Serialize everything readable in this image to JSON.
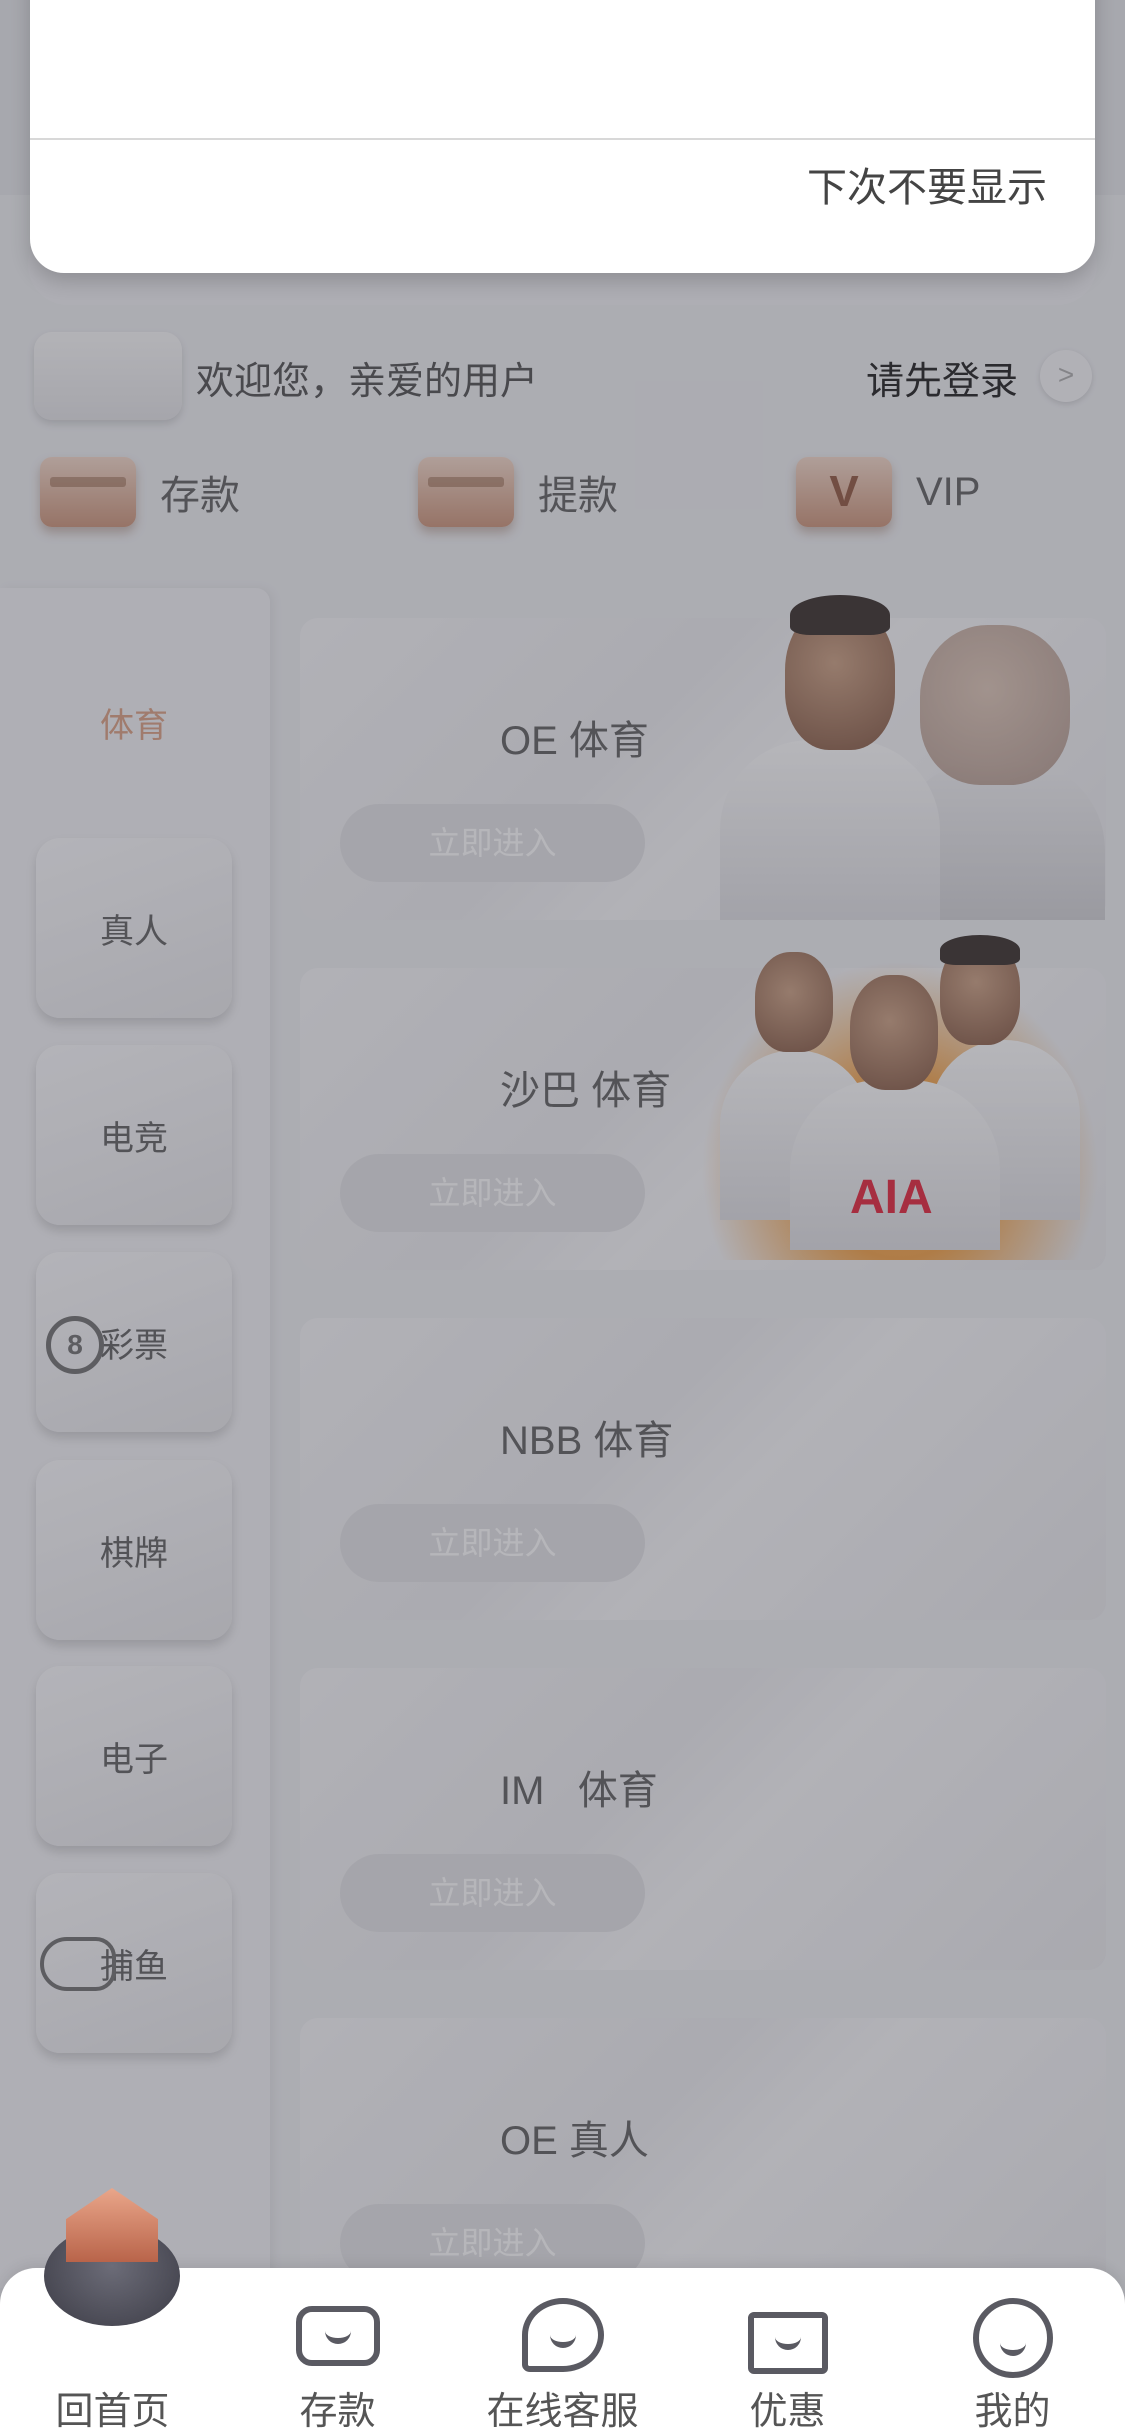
{
  "popup": {
    "dismiss_label": "下次不要显示"
  },
  "welcome": {
    "greeting": "欢迎您，亲爱的用户",
    "login_label": "请先登录",
    "login_arrow": ">"
  },
  "quick_actions": [
    {
      "label": "存款",
      "icon": "wallet-icon"
    },
    {
      "label": "提款",
      "icon": "card-icon"
    },
    {
      "label": "VIP",
      "icon": "vip-icon",
      "glyph": "V"
    }
  ],
  "sidebar": {
    "items": [
      {
        "label": "体育",
        "active": true
      },
      {
        "label": "真人"
      },
      {
        "label": "电竞"
      },
      {
        "label": "彩票",
        "icon": "lottery-ball-icon",
        "glyph": "8"
      },
      {
        "label": "棋牌"
      },
      {
        "label": "电子"
      },
      {
        "label": "捕鱼",
        "icon": "fish-icon"
      }
    ]
  },
  "games": [
    {
      "title": "OE 体育",
      "button": "立即进入"
    },
    {
      "title": "沙巴 体育",
      "button": "立即进入",
      "jersey_text": "AIA"
    },
    {
      "title": "NBB 体育",
      "button": "立即进入"
    },
    {
      "title": "IM   体育",
      "button": "立即进入"
    },
    {
      "title": "OE 真人",
      "button": "立即进入"
    }
  ],
  "tabbar": {
    "items": [
      {
        "label": "回首页",
        "icon": "home-icon"
      },
      {
        "label": "存款",
        "icon": "wallet-icon"
      },
      {
        "label": "在线客服",
        "icon": "chat-icon"
      },
      {
        "label": "优惠",
        "icon": "gift-icon"
      },
      {
        "label": "我的",
        "icon": "profile-icon"
      }
    ]
  },
  "colors": {
    "accent": "#d99a7a",
    "text_primary": "#333333",
    "button_bg": "#e2e2e5",
    "overlay": "rgba(80,80,90,0.42)"
  }
}
